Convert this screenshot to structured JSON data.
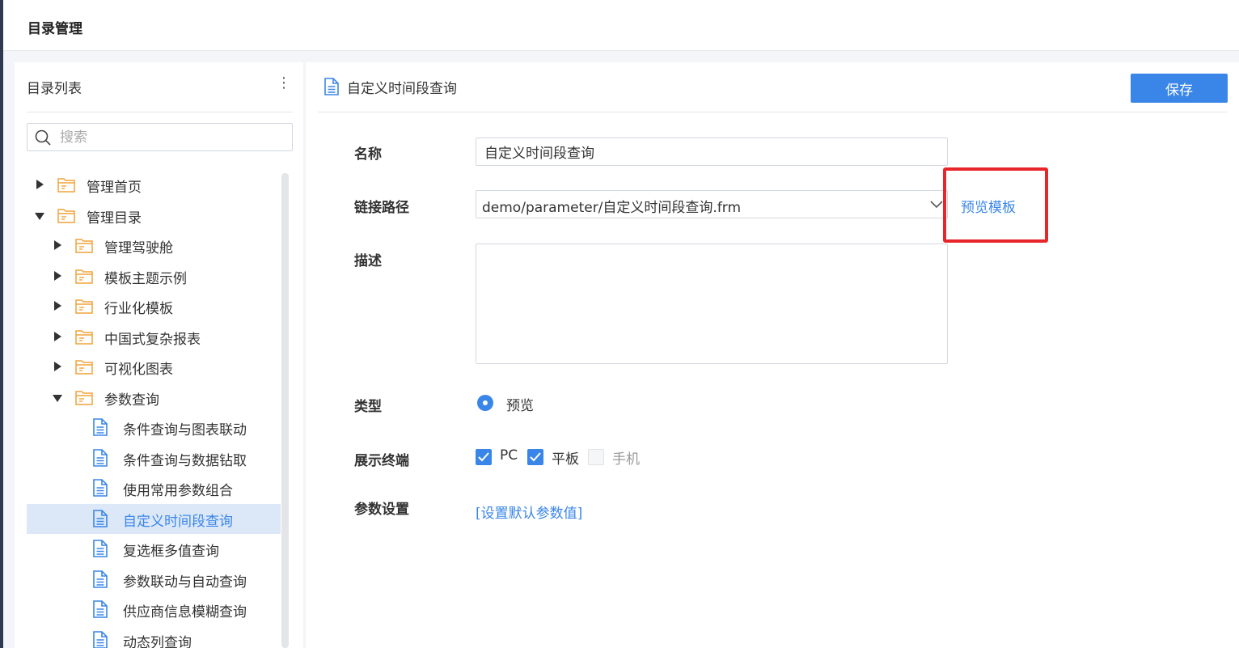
{
  "topbar": {
    "title": "目录管理"
  },
  "left_panel": {
    "title": "目录列表",
    "more_icon": "⋮",
    "search_placeholder": "搜索",
    "tree": [
      {
        "label": "管理首页",
        "level": 0,
        "type": "folder",
        "expanded": false
      },
      {
        "label": "管理目录",
        "level": 0,
        "type": "folder",
        "expanded": true
      },
      {
        "label": "管理驾驶舱",
        "level": 1,
        "type": "folder",
        "expanded": false
      },
      {
        "label": "模板主题示例",
        "level": 1,
        "type": "folder",
        "expanded": false
      },
      {
        "label": "行业化模板",
        "level": 1,
        "type": "folder",
        "expanded": false
      },
      {
        "label": "中国式复杂报表",
        "level": 1,
        "type": "folder",
        "expanded": false
      },
      {
        "label": "可视化图表",
        "level": 1,
        "type": "folder",
        "expanded": false
      },
      {
        "label": "参数查询",
        "level": 1,
        "type": "folder",
        "expanded": true
      },
      {
        "label": "条件查询与图表联动",
        "level": 2,
        "type": "file"
      },
      {
        "label": "条件查询与数据钻取",
        "level": 2,
        "type": "file"
      },
      {
        "label": "使用常用参数组合",
        "level": 2,
        "type": "file"
      },
      {
        "label": "自定义时间段查询",
        "level": 2,
        "type": "file",
        "selected": true
      },
      {
        "label": "复选框多值查询",
        "level": 2,
        "type": "file"
      },
      {
        "label": "参数联动与自动查询",
        "level": 2,
        "type": "file"
      },
      {
        "label": "供应商信息模糊查询",
        "level": 2,
        "type": "file"
      },
      {
        "label": "动态列查询",
        "level": 2,
        "type": "file"
      }
    ]
  },
  "detail": {
    "title": "自定义时间段查询",
    "save_label": "保存",
    "labels": {
      "name": "名称",
      "path": "链接路径",
      "desc": "描述",
      "type": "类型",
      "terminal": "展示终端",
      "params": "参数设置"
    },
    "name_value": "自定义时间段查询",
    "path_value": "demo/parameter/自定义时间段查询.frm",
    "preview_template": "预览模板",
    "type_option": "预览",
    "terminals": [
      {
        "label": "PC",
        "checked": true
      },
      {
        "label": "平板",
        "checked": true
      },
      {
        "label": "手机",
        "checked": false,
        "disabled": true
      }
    ],
    "param_link": "[设置默认参数值]"
  },
  "colors": {
    "accent": "#3a86e8",
    "folder": "#f0a43a",
    "highlight": "#e8262a",
    "selected_bg": "#dce8f8"
  }
}
